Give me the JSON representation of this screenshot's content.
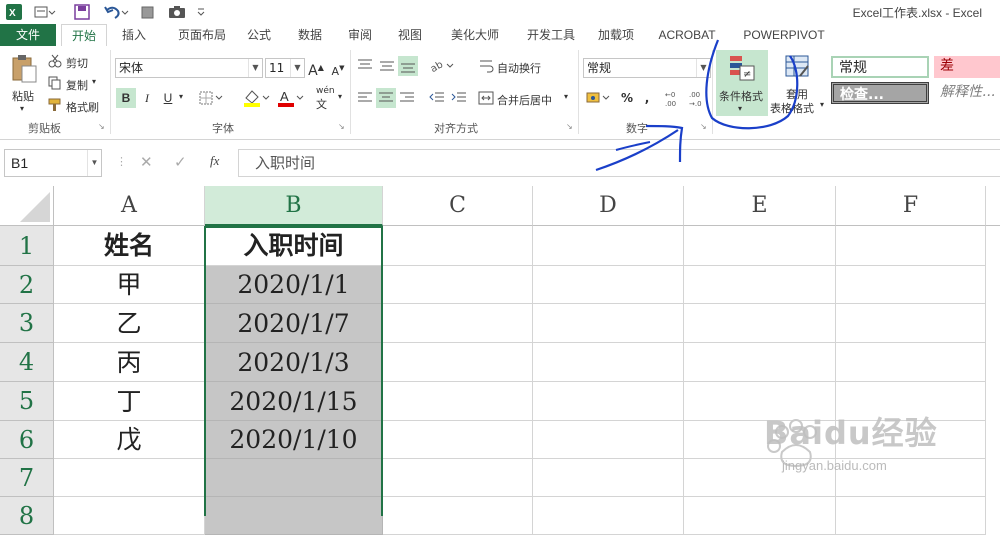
{
  "window": {
    "title": "Excel工作表.xlsx - Excel"
  },
  "quick_access": {
    "icons": [
      "excel-logo-icon",
      "save-icon",
      "undo-icon",
      "print-preview-icon",
      "camera-icon",
      "customize-icon"
    ]
  },
  "tabs": [
    {
      "label": "文件",
      "name": "tab-file"
    },
    {
      "label": "开始",
      "name": "tab-home"
    },
    {
      "label": "插入",
      "name": "tab-insert"
    },
    {
      "label": "页面布局",
      "name": "tab-page-layout"
    },
    {
      "label": "公式",
      "name": "tab-formulas"
    },
    {
      "label": "数据",
      "name": "tab-data"
    },
    {
      "label": "审阅",
      "name": "tab-review"
    },
    {
      "label": "视图",
      "name": "tab-view"
    },
    {
      "label": "美化大师",
      "name": "tab-beautify"
    },
    {
      "label": "开发工具",
      "name": "tab-developer"
    },
    {
      "label": "加载项",
      "name": "tab-addins"
    },
    {
      "label": "ACROBAT",
      "name": "tab-acrobat"
    },
    {
      "label": "POWERPIVOT",
      "name": "tab-powerpivot"
    }
  ],
  "ribbon": {
    "clipboard": {
      "paste": "粘贴",
      "cut": "剪切",
      "copy": "复制",
      "format_painter": "格式刷",
      "label": "剪贴板"
    },
    "font": {
      "name": "宋体",
      "size": "11",
      "label": "字体",
      "bold": "B",
      "italic": "I",
      "underline": "U",
      "grow": "A",
      "shrink": "A",
      "wen": "wén"
    },
    "alignment": {
      "wrap": "自动换行",
      "merge": "合并后居中",
      "label": "对齐方式"
    },
    "number": {
      "format": "常规",
      "label": "数字",
      "percent": "%",
      "comma": ","
    },
    "styles": {
      "conditional": "条件格式",
      "table_format_1": "套用",
      "table_format_2": "表格格式",
      "normal": "常规",
      "bad": "差",
      "check": "检查...",
      "explanatory": "解释性..."
    }
  },
  "formula_bar": {
    "name_box": "B1",
    "fx": "fx",
    "content": "入职时间"
  },
  "sheet": {
    "columns": [
      "A",
      "B",
      "C",
      "D",
      "E",
      "F"
    ],
    "rows": [
      "1",
      "2",
      "3",
      "4",
      "5",
      "6",
      "7",
      "8"
    ],
    "cells": [
      [
        "姓名",
        "入职时间"
      ],
      [
        "甲",
        "2020/1/1"
      ],
      [
        "乙",
        "2020/1/7"
      ],
      [
        "丙",
        "2020/1/3"
      ],
      [
        "丁",
        "2020/1/15"
      ],
      [
        "戊",
        "2020/1/10"
      ],
      [
        "",
        ""
      ],
      [
        "",
        ""
      ]
    ]
  },
  "watermark": {
    "brand": "Baidu经验",
    "url": "jingyan.baidu.com"
  },
  "colors": {
    "excel_green": "#217346",
    "selection_fill": "#c6c6c6",
    "annotation_blue": "#1a3fc9",
    "bad_fill": "#ffc7ce",
    "bad_text": "#9c0006"
  }
}
